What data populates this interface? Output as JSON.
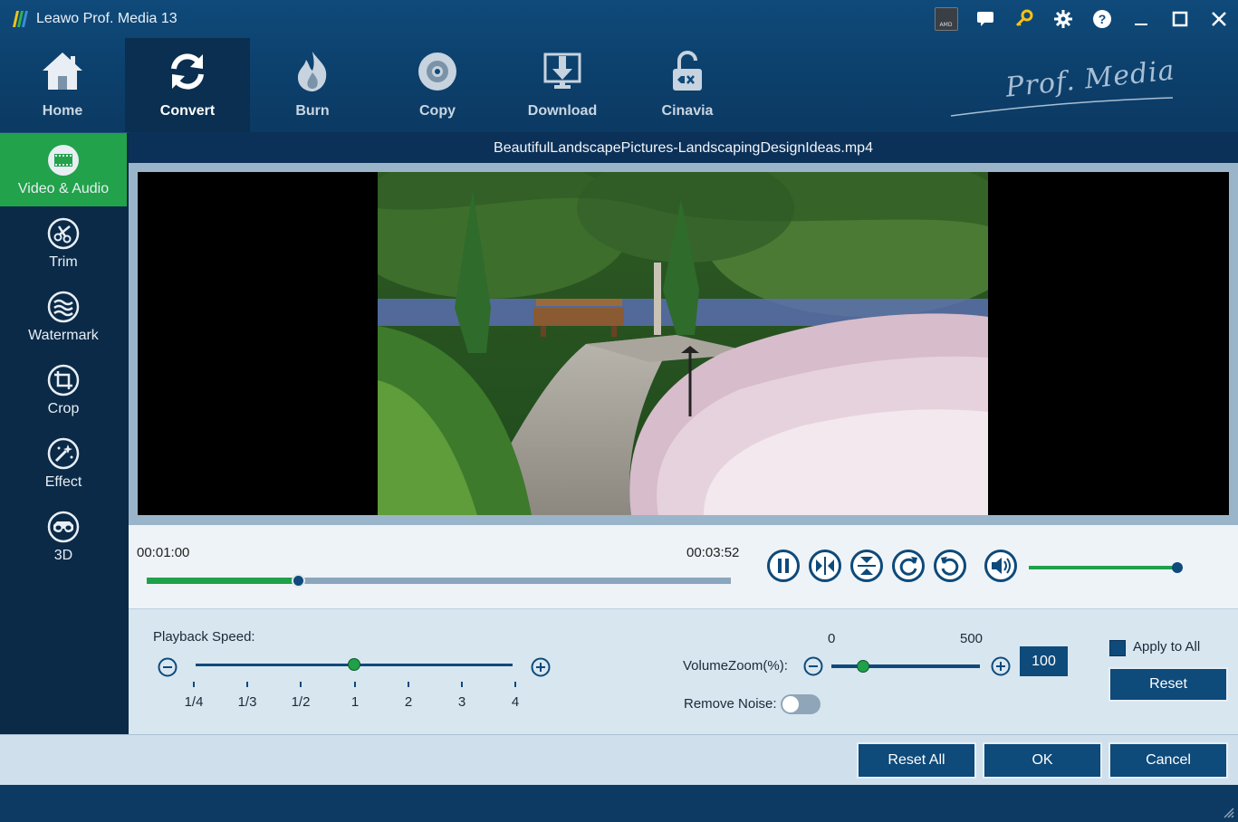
{
  "app": {
    "title": "Leawo Prof. Media 13"
  },
  "titlebar": {
    "icons": [
      "amd-icon",
      "chat-icon",
      "key-icon",
      "gear-icon",
      "help-icon",
      "minimize-icon",
      "maximize-icon",
      "close-icon"
    ],
    "amd_label": "AMD"
  },
  "nav": {
    "items": [
      {
        "label": "Home",
        "icon": "home-icon"
      },
      {
        "label": "Convert",
        "icon": "convert-icon",
        "active": true
      },
      {
        "label": "Burn",
        "icon": "flame-icon"
      },
      {
        "label": "Copy",
        "icon": "disc-icon"
      },
      {
        "label": "Download",
        "icon": "download-icon"
      },
      {
        "label": "Cinavia",
        "icon": "unlock-icon"
      }
    ],
    "brand": "Prof. Media"
  },
  "sidebar": {
    "items": [
      {
        "label": "Video & Audio",
        "icon": "film-icon",
        "active": true
      },
      {
        "label": "Trim",
        "icon": "scissors-icon"
      },
      {
        "label": "Watermark",
        "icon": "watermark-icon"
      },
      {
        "label": "Crop",
        "icon": "crop-icon"
      },
      {
        "label": "Effect",
        "icon": "magic-wand-icon"
      },
      {
        "label": "3D",
        "icon": "3d-glasses-icon"
      }
    ]
  },
  "player": {
    "filename": "BeautifulLandscapePictures-LandscapingDesignIdeas.mp4",
    "current_time": "00:01:00",
    "total_time": "00:03:52",
    "progress": 0.26,
    "volume": 1.0
  },
  "settings": {
    "playback_speed_label": "Playback Speed:",
    "speed_ticks": [
      "1/4",
      "1/3",
      "1/2",
      "1",
      "2",
      "3",
      "4"
    ],
    "speed_selected": "1",
    "volume_zoom_label": "VolumeZoom(%):",
    "volume_zoom_min": "0",
    "volume_zoom_max": "500",
    "volume_zoom_value": "100",
    "remove_noise_label": "Remove Noise:",
    "remove_noise_on": false,
    "apply_to_all_label": "Apply to All",
    "reset_label": "Reset"
  },
  "footer": {
    "reset_all_label": "Reset All",
    "ok_label": "OK",
    "cancel_label": "Cancel"
  },
  "colors": {
    "nav_bg": "#0f4a7a",
    "active_green": "#22a24b",
    "accent_blue": "#0e4a7a",
    "panel_bg": "#cfe0ec"
  }
}
